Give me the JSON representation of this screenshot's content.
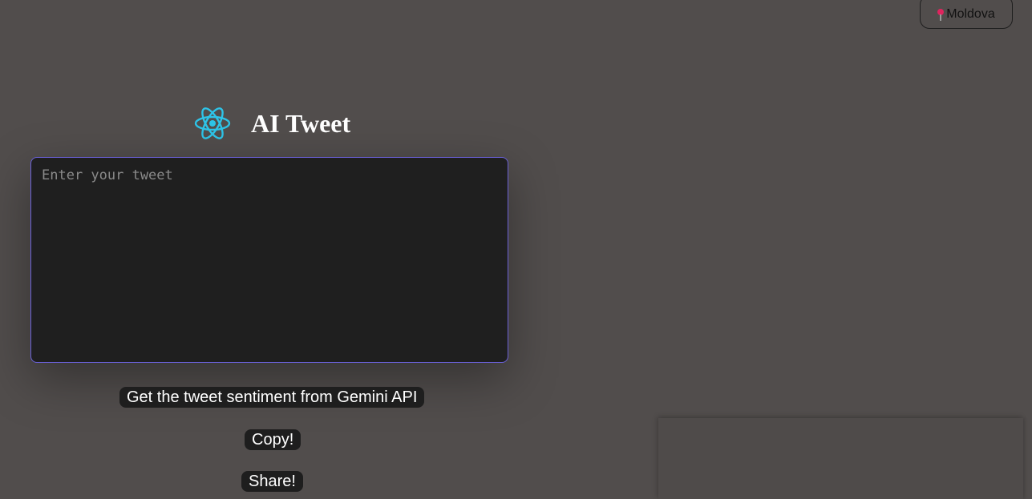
{
  "location": {
    "icon": "pin-icon",
    "label": "Moldova"
  },
  "header": {
    "logo_icon": "react-atom-icon",
    "title": "AI Tweet"
  },
  "editor": {
    "placeholder": "Enter your tweet",
    "value": ""
  },
  "actions": {
    "sentiment_label": "Get the tweet sentiment from Gemini API",
    "copy_label": "Copy!",
    "share_label": "Share!"
  },
  "colors": {
    "background": "#514d4c",
    "editor_bg": "#1f1f1f",
    "editor_border": "#6a60d6",
    "accent": "#2ec4e8",
    "button_bg": "#1e1e1e"
  }
}
